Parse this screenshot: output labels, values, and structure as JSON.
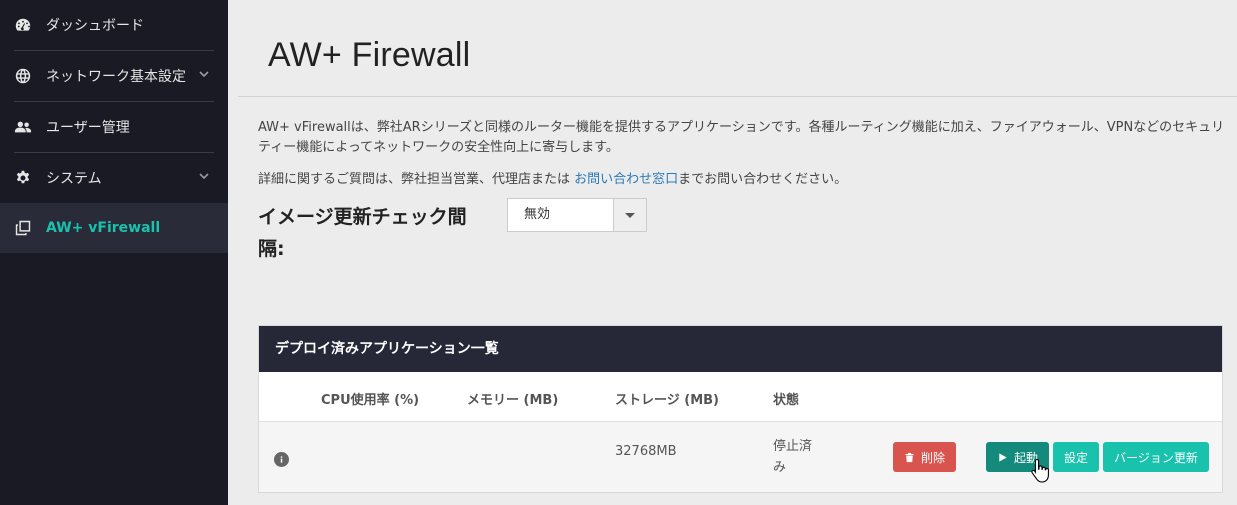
{
  "sidebar": {
    "items": [
      {
        "label": "ダッシュボード",
        "icon": "dashboard-icon"
      },
      {
        "label": "ネットワーク基本設定",
        "icon": "globe-icon",
        "expandable": true
      },
      {
        "label": "ユーザー管理",
        "icon": "users-icon"
      },
      {
        "label": "システム",
        "icon": "gear-icon",
        "expandable": true
      },
      {
        "label": "AW+ vFirewall",
        "icon": "clone-icon",
        "active": true
      }
    ]
  },
  "page": {
    "title": "AW+ Firewall",
    "description": "AW+ vFirewallは、弊社ARシリーズと同様のルーター機能を提供するアプリケーションです。各種ルーティング機能に加え、ファイアウォール、VPNなどのセキュリティー機能によってネットワークの安全性向上に寄与します。",
    "inquiry_prefix": "詳細に関するご質問は、弊社担当営業、代理店または ",
    "inquiry_link": "お問い合わせ窓口",
    "inquiry_suffix": "までお問い合わせください。"
  },
  "image_check": {
    "label": "イメージ更新チェック間隔:",
    "selected": "無効"
  },
  "deployed": {
    "title": "デプロイ済みアプリケーション一覧",
    "columns": [
      "CPU使用率 (%)",
      "メモリー (MB)",
      "ストレージ (MB)",
      "状態"
    ],
    "rows": [
      {
        "cpu": "",
        "memory": "",
        "storage": "32768MB",
        "status": "停止済み",
        "buttons": {
          "delete": "削除",
          "start": "起動",
          "settings": "設定",
          "update": "バージョン更新"
        }
      }
    ]
  },
  "colors": {
    "sidebar_bg": "#191a24",
    "accent": "#19c2ac",
    "danger": "#d9534f",
    "start": "#138a7c"
  }
}
